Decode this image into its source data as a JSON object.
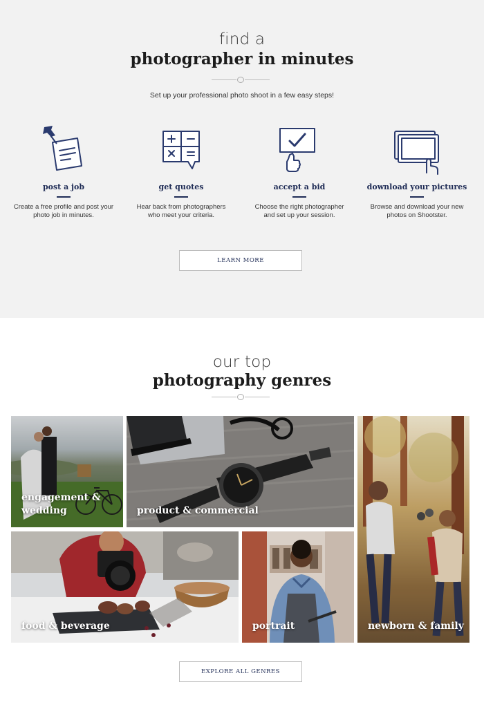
{
  "how_it_works": {
    "title_light": "find a",
    "title_bold": "photographer in minutes",
    "subtitle": "Set up your professional photo shoot in a few easy steps!",
    "steps": [
      {
        "icon": "pin-note-icon",
        "label": "post a job",
        "desc_1": "Create a free profile and post your",
        "desc_2": "photo job in minutes."
      },
      {
        "icon": "calculator-icon",
        "label": "get quotes",
        "desc_1": "Hear back from photographers",
        "desc_2": "who meet your criteria."
      },
      {
        "icon": "thumbs-up-check-icon",
        "label": "accept a bid",
        "desc_1": "Choose the right photographer",
        "desc_2": "and set up your session."
      },
      {
        "icon": "touch-screen-icon",
        "label": "download your pictures",
        "desc_1": "Browse and download your new",
        "desc_2": "photos on Shootster."
      }
    ],
    "button_label": "LEARN MORE"
  },
  "genres": {
    "title_light": "our top",
    "title_bold": "photography genres",
    "tiles": [
      {
        "line_1": "engagement &",
        "line_2": "wedding"
      },
      {
        "line_1": "product & commercial"
      },
      {
        "line_1": "newborn & family"
      },
      {
        "line_1": "food & beverage"
      },
      {
        "line_1": "portrait"
      }
    ],
    "button_label": "EXPLORE ALL GENRES"
  },
  "colors": {
    "accent": "#1e2b55",
    "section_bg": "#f2f2f2"
  }
}
